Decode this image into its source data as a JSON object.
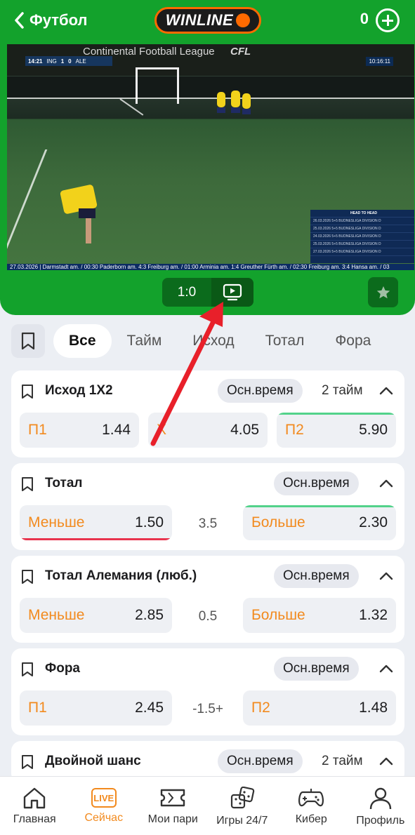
{
  "header": {
    "back_label": "Футбол",
    "logo_text": "WINLINE",
    "balance": "0",
    "accent": "#13a22c",
    "brand_orange": "#ff6a00"
  },
  "video": {
    "scorebug": {
      "time": "14:21",
      "home": "ING",
      "home_score": "1",
      "away_score": "0",
      "away": "ALE"
    },
    "league_text": "Continental Football League",
    "league_short": "CFL",
    "clock": "10:16:11",
    "h2h_title": "HEAD TO HEAD",
    "h2h_rows": [
      "26.03.2026 5+5 BUDNESLIGA DIVISION D",
      "25.03.2026 5+5 BUDNESLIGA DIVISION D",
      "24.03.2026 5+5 BUDNESLIGA DIVISION D",
      "25.03.2026 5+5 BUDNESLIGA DIVISION D",
      "27.03.2026 5+5 BUDNESLIGA DIVISION D"
    ],
    "ticker": "27.03.2026 | Darmstadt am. / 00:30 Paderborn am. 4:3 Freiburg am. / 01:00 Arminia am. 1:4 Greuther Fürth am. / 02:30 Freiburg am. 3:4 Hansa am. / 03"
  },
  "scorebar": {
    "score": "1:0"
  },
  "filters": {
    "tabs": [
      "Все",
      "Тайм",
      "Исход",
      "Тотал",
      "Фора"
    ],
    "active": "Все"
  },
  "markets": {
    "outcome": {
      "title": "Исход 1X2",
      "period": "Осн.время",
      "period2": "2 тайм",
      "p1_label": "П1",
      "p1_value": "1.44",
      "x_label": "X",
      "x_value": "4.05",
      "p2_label": "П2",
      "p2_value": "5.90"
    },
    "total": {
      "title": "Тотал",
      "period": "Осн.время",
      "under_label": "Меньше",
      "under_value": "1.50",
      "line": "3.5",
      "over_label": "Больше",
      "over_value": "2.30"
    },
    "team_total": {
      "title": "Тотал Алемания (люб.)",
      "period": "Осн.время",
      "under_label": "Меньше",
      "under_value": "2.85",
      "line": "0.5",
      "over_label": "Больше",
      "over_value": "1.32"
    },
    "handicap": {
      "title": "Фора",
      "period": "Осн.время",
      "p1_label": "П1",
      "p1_value": "2.45",
      "line": "-1.5+",
      "p2_label": "П2",
      "p2_value": "1.48"
    },
    "double_chance": {
      "title": "Двойной шанс",
      "period": "Осн.время",
      "period2": "2 тайм"
    }
  },
  "nav": {
    "items": [
      "Главная",
      "Сейчас",
      "Мои пари",
      "Игры 24/7",
      "Кибер",
      "Профиль"
    ],
    "live_badge": "LIVE",
    "active_color": "#f28a1e"
  }
}
